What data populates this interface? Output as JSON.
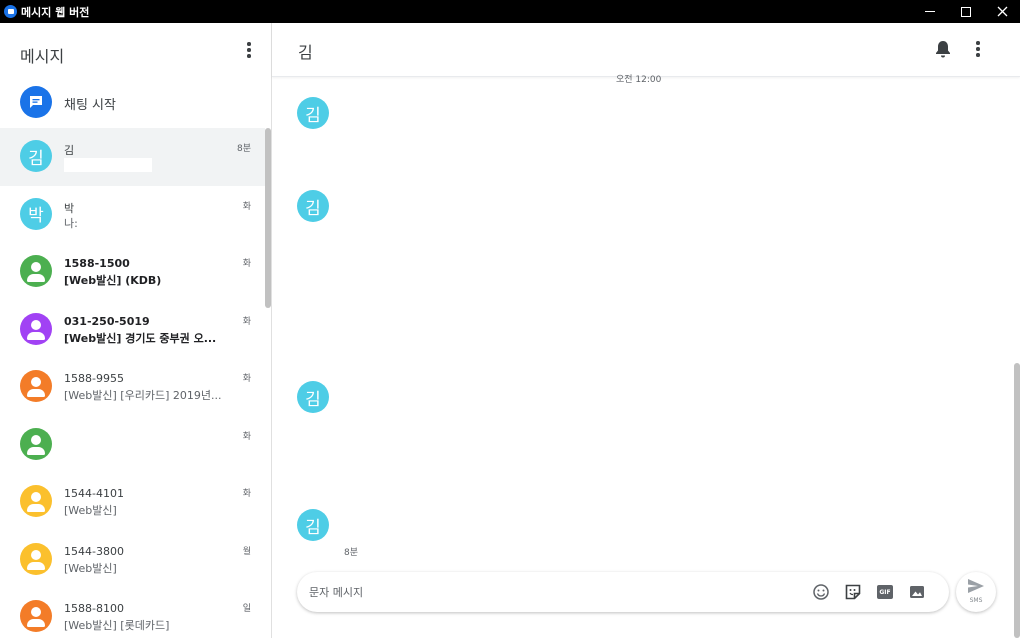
{
  "window": {
    "title": "메시지 웹 버전"
  },
  "sidebar": {
    "title": "메시지",
    "start_chat_label": "채팅 시작",
    "conversations": [
      {
        "avatar": "김",
        "name": "김",
        "snippet": "",
        "time": "8분",
        "color": "#4ecde6",
        "unread": false,
        "selected": true
      },
      {
        "avatar": "박",
        "name": "박",
        "snippet": "나:",
        "time": "화",
        "color": "#4ecde6",
        "unread": false,
        "selected": false
      },
      {
        "avatar": "",
        "name": "1588-1500",
        "snippet": "[Web발신] (KDB)",
        "time": "화",
        "color": "#4caf50",
        "unread": true,
        "selected": false
      },
      {
        "avatar": "",
        "name": "031-250-5019",
        "snippet": "[Web발신] 경기도 중부권 오...",
        "time": "화",
        "color": "#a142f4",
        "unread": true,
        "selected": false
      },
      {
        "avatar": "",
        "name": "1588-9955",
        "snippet": "[Web발신] [우리카드] 2019년...",
        "time": "화",
        "color": "#f37c28",
        "unread": false,
        "selected": false
      },
      {
        "avatar": "",
        "name": "",
        "snippet": "",
        "time": "화",
        "color": "#4caf50",
        "unread": false,
        "selected": false
      },
      {
        "avatar": "",
        "name": "1544-4101",
        "snippet": "[Web발신]",
        "time": "화",
        "color": "#fbc02d",
        "unread": false,
        "selected": false
      },
      {
        "avatar": "",
        "name": "1544-3800",
        "snippet": "[Web발신]",
        "time": "월",
        "color": "#fbc02d",
        "unread": false,
        "selected": false
      },
      {
        "avatar": "",
        "name": "1588-8100",
        "snippet": "[Web발신] [롯데카드]",
        "time": "일",
        "color": "#f37c28",
        "unread": false,
        "selected": false
      }
    ]
  },
  "main": {
    "title": "김",
    "date_separator": "오전 12:00",
    "messages": [
      {
        "avatar": "김"
      },
      {
        "avatar": "김"
      },
      {
        "avatar": "김"
      },
      {
        "avatar": "김"
      }
    ],
    "last_message_time": "8분",
    "composer": {
      "placeholder": "문자 메시지",
      "send_label": "SMS",
      "gif_label": "GIF"
    }
  },
  "colors": {
    "accent": "#1a73e8",
    "contact_cyan": "#4ecde6"
  }
}
